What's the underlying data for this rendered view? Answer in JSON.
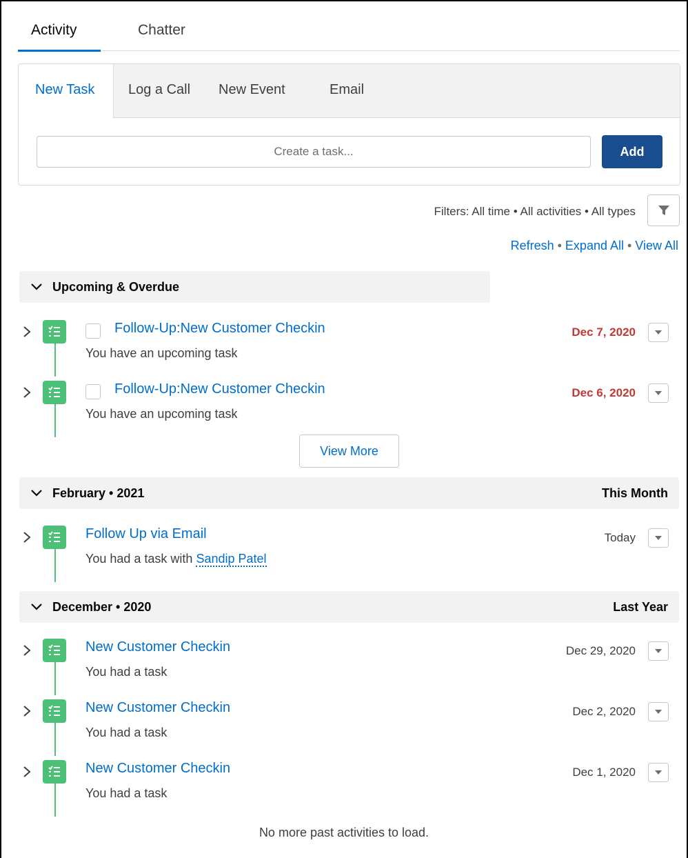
{
  "tabs": [
    {
      "label": "Activity",
      "active": true
    },
    {
      "label": "Chatter",
      "active": false
    }
  ],
  "composer": {
    "tabs": [
      {
        "label": "New Task",
        "active": true
      },
      {
        "label": "Log a Call",
        "active": false
      },
      {
        "label": "New Event",
        "active": false
      },
      {
        "label": "Email",
        "active": false
      }
    ],
    "input_placeholder": "Create a task...",
    "add_label": "Add"
  },
  "filters": {
    "text": "Filters: All time • All activities • All types",
    "icon": "filter-icon"
  },
  "actions": {
    "refresh": "Refresh",
    "expand_all": "Expand All",
    "view_all": "View All",
    "separator": "•"
  },
  "sections": {
    "upcoming": {
      "title": "Upcoming & Overdue",
      "items": [
        {
          "title": "Follow-Up:New Customer Checkin",
          "subtitle": "You have an upcoming task",
          "date": "Dec 7, 2020",
          "overdue": true
        },
        {
          "title": "Follow-Up:New Customer Checkin",
          "subtitle": "You have an upcoming task",
          "date": "Dec 6, 2020",
          "overdue": true
        }
      ],
      "view_more": "View More"
    },
    "february": {
      "title": "February • 2021",
      "right": "This Month",
      "items": [
        {
          "title": "Follow Up via Email",
          "subtitle_prefix": "You had a task with",
          "person": "Sandip Patel",
          "date": "Today"
        }
      ]
    },
    "december": {
      "title": "December • 2020",
      "right": "Last Year",
      "items": [
        {
          "title": "New Customer Checkin",
          "subtitle": "You had a task",
          "date": "Dec 29, 2020"
        },
        {
          "title": "New Customer Checkin",
          "subtitle": "You had a task",
          "date": "Dec 2, 2020"
        },
        {
          "title": "New Customer Checkin",
          "subtitle": "You had a task",
          "date": "Dec 1, 2020"
        }
      ]
    }
  },
  "footer": "No more past activities to load.",
  "colors": {
    "link": "#006dcc",
    "brand_button": "#1a4d8f",
    "task_icon": "#4bc076",
    "overdue": "#c23934",
    "section_bg": "#f3f2f2"
  }
}
